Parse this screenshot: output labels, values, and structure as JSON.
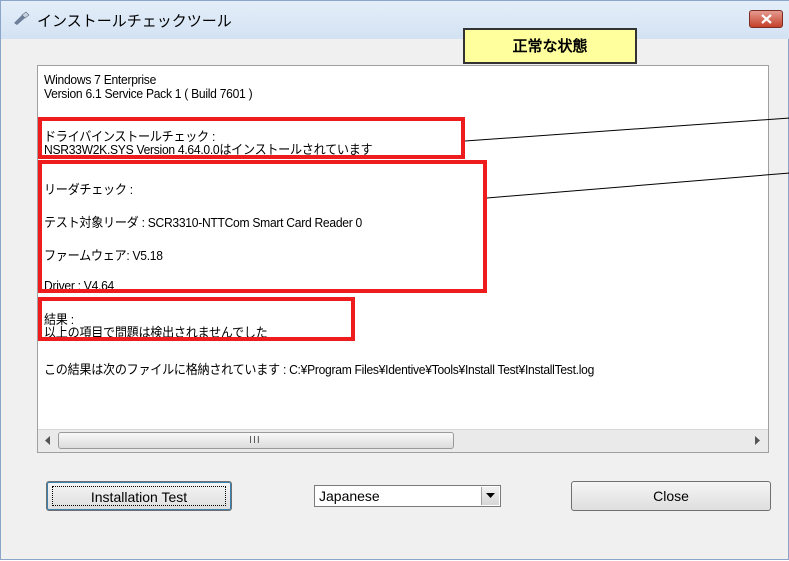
{
  "window": {
    "title": "インストールチェックツール",
    "status_label": "正常な状態"
  },
  "log": {
    "lines": [
      "Windows 7 Enterprise",
      "Version 6.1 Service Pack 1 ( Build 7601 )",
      "ドライバインストールチェック :",
      "NSR33W2K.SYS Version 4.64.0.0はインストールされています",
      "リーダチェック :",
      "テスト対象リーダ : SCR3310-NTTCom Smart Card Reader 0",
      "ファームウェア: V5.18",
      "Driver : V4.64",
      "結果 :",
      "以上の項目で問題は検出されませんでした",
      "この結果は次のファイルに格納されています : C:¥Program Files¥Identive¥Tools¥Install Test¥InstallTest.log"
    ]
  },
  "controls": {
    "install_button": "Installation Test",
    "language_value": "Japanese",
    "close_button": "Close"
  },
  "colors": {
    "highlight": "#ee1c1c",
    "status_bg": "#ffff9e"
  },
  "icons": {
    "title": "app-icon",
    "close": "close-x-icon",
    "scroll_left": "arrow-left-icon",
    "scroll_right": "arrow-right-icon",
    "combo": "chevron-down-icon"
  }
}
